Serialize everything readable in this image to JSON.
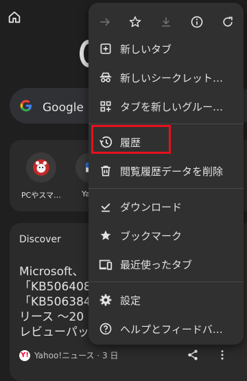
{
  "background": {
    "search_text": "Google で",
    "shortcuts": [
      {
        "label": "PCやスマ…",
        "icon": "bear-icon"
      },
      {
        "label": "Yaho",
        "icon": "site-icon"
      }
    ],
    "discover": {
      "label": "Discover",
      "article_title": "Microsoft、\n「KB506408\n「KB506384\nリース 〜20\nレビューパッ",
      "source": "Yahoo!ニュース · 3 日"
    }
  },
  "menu": {
    "toolbar": [
      {
        "name": "forward-icon",
        "enabled": false
      },
      {
        "name": "star-icon",
        "enabled": true
      },
      {
        "name": "download-icon",
        "enabled": false
      },
      {
        "name": "info-icon",
        "enabled": true
      },
      {
        "name": "reload-icon",
        "enabled": true
      }
    ],
    "items": [
      {
        "label": "新しいタブ",
        "icon": "new-tab-icon"
      },
      {
        "label": "新しいシークレット…",
        "icon": "incognito-icon"
      },
      {
        "label": "タブを新しいグルー…",
        "icon": "tab-group-icon"
      },
      {
        "label": "履歴",
        "icon": "history-icon",
        "highlighted": true
      },
      {
        "label": "閲覧履歴データを削除",
        "icon": "trash-icon"
      },
      {
        "label": "ダウンロード",
        "icon": "download-done-icon"
      },
      {
        "label": "ブックマーク",
        "icon": "bookmark-star-icon"
      },
      {
        "label": "最近使ったタブ",
        "icon": "recent-tabs-icon"
      },
      {
        "label": "設定",
        "icon": "settings-gear-icon"
      },
      {
        "label": "ヘルプとフィードバ…",
        "icon": "help-icon"
      }
    ],
    "highlight_color": "#e8101c"
  }
}
